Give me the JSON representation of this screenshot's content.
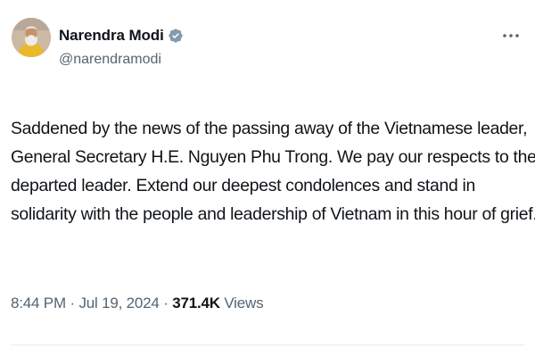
{
  "author": {
    "name": "Narendra Modi",
    "handle": "@narendramodi",
    "verified": true,
    "verified_color": "#829aab"
  },
  "post": {
    "lines": [
      "Saddened by the news of the passing away of the Vietnamese leader,",
      "General Secretary H.E. Nguyen Phu Trong. We pay our respects to the",
      "departed leader.  Extend our deepest condolences and stand in",
      "solidarity with the people and leadership of Vietnam in this hour of grief."
    ]
  },
  "meta": {
    "time": "8:44 PM",
    "separator1": " · ",
    "date": "Jul 19, 2024",
    "separator2": " · ",
    "views_count": "371.4K",
    "views_label": " Views"
  },
  "icons": {
    "more": "more-options-icon",
    "verified": "verified-badge-icon"
  }
}
